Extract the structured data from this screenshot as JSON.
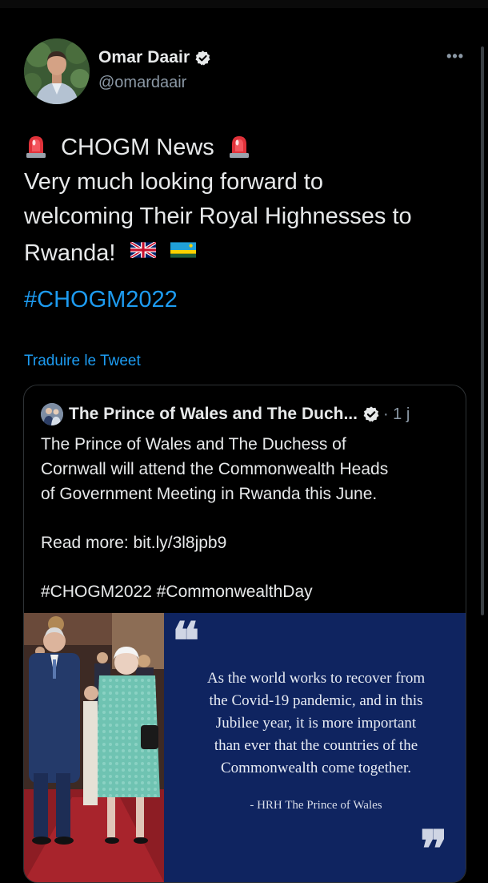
{
  "tweet": {
    "author": {
      "display_name": "Omar Daair",
      "handle": "@omardaair",
      "verified": true
    },
    "more_icon": "more-options-icon",
    "text_lines": [
      "CHOGM News",
      "Very much looking forward to",
      "welcoming Their Royal Highnesses to",
      "Rwanda!"
    ],
    "hashtag": "#CHOGM2022",
    "translate_label": "Traduire le Tweet"
  },
  "quoted_tweet": {
    "author_name": "The Prince of Wales and The Duch...",
    "time": "· 1 j",
    "verified": true,
    "body_lines": [
      "The Prince of Wales and The Duchess of",
      "Cornwall will attend the Commonwealth Heads",
      "of Government Meeting in Rwanda this June."
    ],
    "read_more": "Read more: bit.ly/3l8jpb9",
    "hashtags": "#CHOGM2022 #CommonwealthDay",
    "media": {
      "quote_lines": [
        "As the world works to recover from",
        "the Covid-19 pandemic, and in this",
        "Jubilee year, it is more important",
        "than ever that the countries of the",
        "Commonwealth come together."
      ],
      "attribution": "- HRH The Prince of Wales",
      "open_quote": "❝",
      "close_quote": "❞"
    }
  },
  "colors": {
    "background": "#000000",
    "text": "#e7e9ea",
    "secondary": "#8b98a5",
    "link": "#1d9bf0",
    "quote_panel": "#0f2460"
  }
}
